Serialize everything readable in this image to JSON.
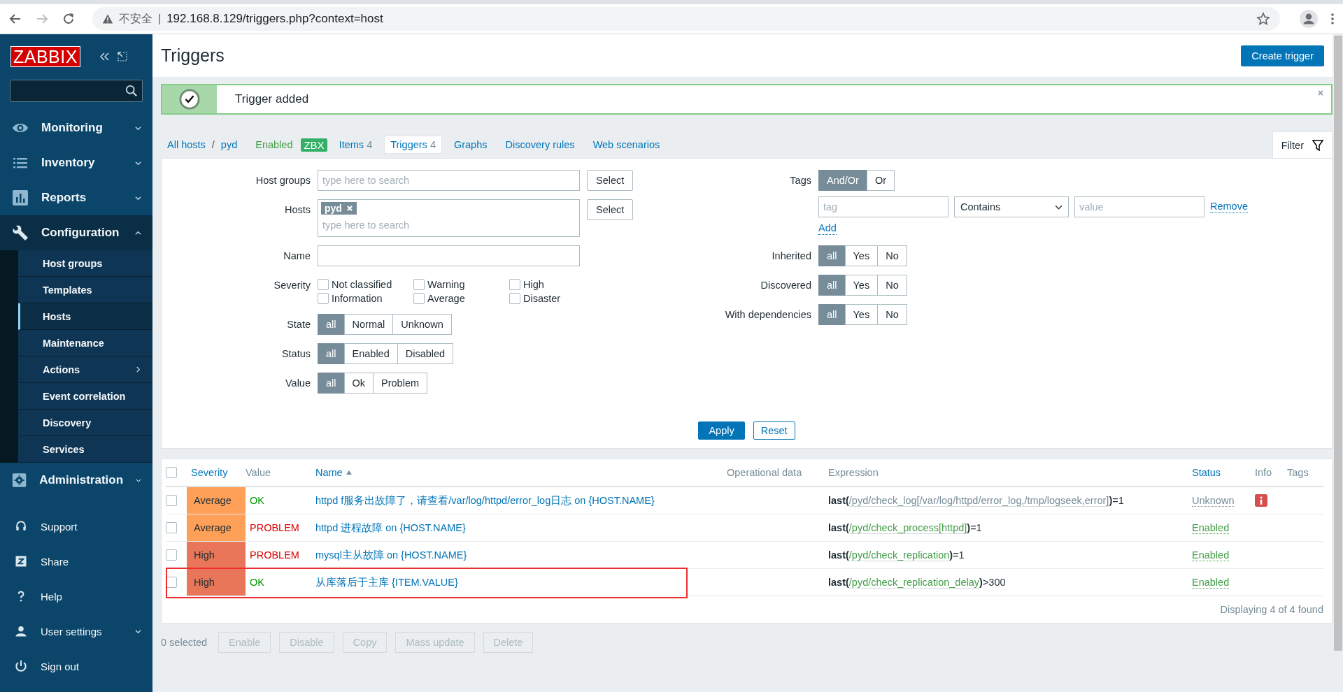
{
  "browser": {
    "warning": "不安全",
    "separator": "|",
    "url": "192.168.8.129/triggers.php?context=host"
  },
  "sidebar": {
    "logo": "ZABBIX",
    "menu": [
      {
        "label": "Monitoring",
        "expanded": false
      },
      {
        "label": "Inventory",
        "expanded": false
      },
      {
        "label": "Reports",
        "expanded": false
      },
      {
        "label": "Configuration",
        "expanded": true,
        "children": [
          {
            "label": "Host groups",
            "selected": false,
            "has_submenu": false
          },
          {
            "label": "Templates",
            "selected": false,
            "has_submenu": false
          },
          {
            "label": "Hosts",
            "selected": true,
            "has_submenu": false
          },
          {
            "label": "Maintenance",
            "selected": false,
            "has_submenu": false
          },
          {
            "label": "Actions",
            "selected": false,
            "has_submenu": true
          },
          {
            "label": "Event correlation",
            "selected": false,
            "has_submenu": false
          },
          {
            "label": "Discovery",
            "selected": false,
            "has_submenu": false
          },
          {
            "label": "Services",
            "selected": false,
            "has_submenu": false
          }
        ]
      },
      {
        "label": "Administration",
        "expanded": false
      }
    ],
    "bottom": [
      {
        "label": "Support",
        "has_menu": false
      },
      {
        "label": "Share",
        "has_menu": false
      },
      {
        "label": "Help",
        "has_menu": false
      },
      {
        "label": "User settings",
        "has_menu": true
      },
      {
        "label": "Sign out",
        "has_menu": false
      }
    ]
  },
  "page": {
    "title": "Triggers",
    "create_button": "Create trigger",
    "message": {
      "text": "Trigger added",
      "kind": "success"
    }
  },
  "nav": {
    "breadcrumbs": [
      "All hosts",
      "pyd"
    ],
    "separator": "/",
    "host_status": "Enabled",
    "badge": "ZBX",
    "tabs": [
      {
        "label": "Items",
        "count": "4",
        "selected": false
      },
      {
        "label": "Triggers",
        "count": "4",
        "selected": true
      },
      {
        "label": "Graphs",
        "selected": false
      },
      {
        "label": "Discovery rules",
        "selected": false
      },
      {
        "label": "Web scenarios",
        "selected": false
      }
    ],
    "filter_tab": "Filter"
  },
  "filter": {
    "host_groups": {
      "label": "Host groups",
      "placeholder": "type here to search",
      "button": "Select"
    },
    "hosts": {
      "label": "Hosts",
      "chips": [
        "pyd"
      ],
      "placeholder": "type here to search",
      "button": "Select"
    },
    "name": {
      "label": "Name"
    },
    "severity": {
      "label": "Severity",
      "options": [
        {
          "label": "Not classified",
          "checked": false
        },
        {
          "label": "Information",
          "checked": false
        },
        {
          "label": "Warning",
          "checked": false
        },
        {
          "label": "Average",
          "checked": false
        },
        {
          "label": "High",
          "checked": false
        },
        {
          "label": "Disaster",
          "checked": false
        }
      ]
    },
    "segments_left": [
      {
        "label": "State",
        "options": [
          {
            "label": "all",
            "selected": true
          },
          {
            "label": "Normal",
            "selected": false
          },
          {
            "label": "Unknown",
            "selected": false
          }
        ]
      },
      {
        "label": "Status",
        "options": [
          {
            "label": "all",
            "selected": true
          },
          {
            "label": "Enabled",
            "selected": false
          },
          {
            "label": "Disabled",
            "selected": false
          }
        ]
      },
      {
        "label": "Value",
        "options": [
          {
            "label": "all",
            "selected": true
          },
          {
            "label": "Ok",
            "selected": false
          },
          {
            "label": "Problem",
            "selected": false
          }
        ]
      }
    ],
    "tags": {
      "label": "Tags",
      "options": [
        {
          "label": "And/Or",
          "selected": true
        },
        {
          "label": "Or",
          "selected": false
        }
      ],
      "tag_placeholder": "tag",
      "operator": "Contains",
      "value_placeholder": "value",
      "remove": "Remove",
      "add": "Add"
    },
    "segments_right": [
      {
        "label": "Inherited",
        "options": [
          {
            "label": "all",
            "selected": true
          },
          {
            "label": "Yes",
            "selected": false
          },
          {
            "label": "No",
            "selected": false
          }
        ]
      },
      {
        "label": "Discovered",
        "options": [
          {
            "label": "all",
            "selected": true
          },
          {
            "label": "Yes",
            "selected": false
          },
          {
            "label": "No",
            "selected": false
          }
        ]
      },
      {
        "label": "With dependencies",
        "options": [
          {
            "label": "all",
            "selected": true
          },
          {
            "label": "Yes",
            "selected": false
          },
          {
            "label": "No",
            "selected": false
          }
        ]
      }
    ],
    "apply": "Apply",
    "reset": "Reset"
  },
  "table": {
    "select_all": {
      "checked": false
    },
    "columns": [
      {
        "label": "Severity",
        "link": true,
        "sorted": false
      },
      {
        "label": "Value",
        "link": false,
        "sorted": false
      },
      {
        "label": "Name",
        "link": true,
        "sorted": true
      },
      {
        "label": "Operational data",
        "link": false,
        "sorted": false
      },
      {
        "label": "Expression",
        "link": false,
        "sorted": false
      },
      {
        "label": "Status",
        "link": true,
        "sorted": false
      },
      {
        "label": "Info",
        "link": false,
        "sorted": false
      },
      {
        "label": "Tags",
        "link": false,
        "sorted": false
      }
    ],
    "rows": [
      {
        "checked": false,
        "severity": "Average",
        "color": "#ffa059",
        "value": "OK",
        "problem": false,
        "name": "httpd f服务出故障了，请查看/var/log/httpd/error_log日志 on {HOST.NAME}",
        "expression": {
          "head": "last(",
          "item": "/pyd/check_log[/var/log/httpd/error_log,/tmp/logseek,error]",
          "close": ")",
          "tail": "=1",
          "item_ok": false
        },
        "status": "Unknown",
        "status_ok": false,
        "info_error": true,
        "highlighted": false
      },
      {
        "checked": false,
        "severity": "Average",
        "color": "#ffa059",
        "value": "PROBLEM",
        "problem": true,
        "name": "httpd 进程故障 on {HOST.NAME}",
        "expression": {
          "head": "last(",
          "item": "/pyd/check_process[httpd]",
          "close": ")",
          "tail": "=1",
          "item_ok": true
        },
        "status": "Enabled",
        "status_ok": true,
        "info_error": false,
        "highlighted": false
      },
      {
        "checked": false,
        "severity": "High",
        "color": "#e97659",
        "value": "PROBLEM",
        "problem": true,
        "name": "mysql主从故障 on {HOST.NAME}",
        "expression": {
          "head": "last(",
          "item": "/pyd/check_replication",
          "close": ")",
          "tail": "=1",
          "item_ok": true
        },
        "status": "Enabled",
        "status_ok": true,
        "info_error": false,
        "highlighted": false
      },
      {
        "checked": false,
        "severity": "High",
        "color": "#e97659",
        "value": "OK",
        "problem": false,
        "name": "从库落后于主库 {ITEM.VALUE}",
        "expression": {
          "head": "last(",
          "item": "/pyd/check_replication_delay",
          "close": ")",
          "tail": ">300",
          "item_ok": true
        },
        "status": "Enabled",
        "status_ok": true,
        "info_error": false,
        "highlighted": true
      }
    ],
    "footer": "Displaying 4 of 4 found"
  },
  "actions": {
    "selected_count": "0 selected",
    "buttons": [
      {
        "label": "Enable",
        "disabled": true
      },
      {
        "label": "Disable",
        "disabled": true
      },
      {
        "label": "Copy",
        "disabled": true
      },
      {
        "label": "Mass update",
        "disabled": true
      },
      {
        "label": "Delete",
        "disabled": true
      }
    ]
  }
}
